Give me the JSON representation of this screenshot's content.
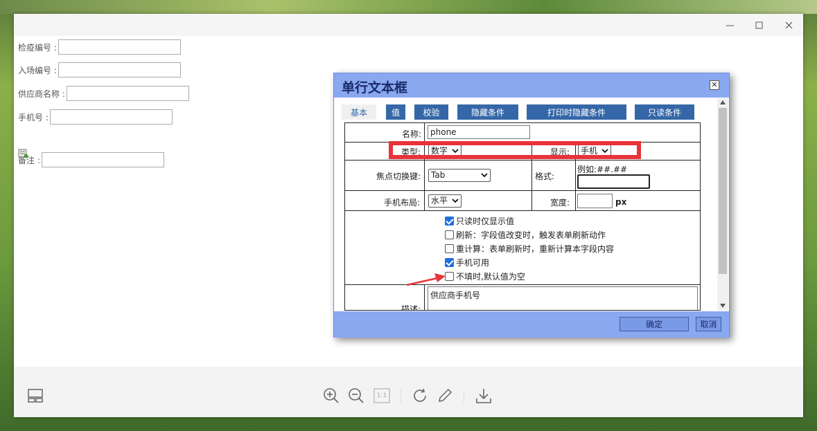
{
  "form": {
    "field_1_label": "检疫编号 :",
    "field_2_label": "入场编号 :",
    "field_3_label": "供应商名称 :",
    "field_4_label": "手机号 :",
    "field_5_label": "备注 :"
  },
  "dialog": {
    "title": "单行文本框",
    "tabs": [
      "基本",
      "值",
      "校验",
      "隐藏条件",
      "打印时隐藏条件",
      "只读条件"
    ],
    "name_label": "名称:",
    "name_value": "phone",
    "type_label": "类型:",
    "type_value": "数字",
    "display_label": "显示:",
    "display_value": "手机",
    "focus_label": "焦点切换键:",
    "focus_value": "Tab",
    "format_label": "格式:",
    "format_hint": "例如:##.##",
    "mobile_layout_label": "手机布局:",
    "mobile_layout_value": "水平",
    "width_label": "宽度:",
    "width_unit": "px",
    "checkboxes": [
      {
        "label": "只读时仅显示值",
        "checked": true
      },
      {
        "label": "刷新：字段值改变时，触发表单刷新动作",
        "checked": false
      },
      {
        "label": "重计算：表单刷新时，重新计算本字段内容",
        "checked": false
      },
      {
        "label": "手机可用",
        "checked": true
      },
      {
        "label": "不填时,默认值为空",
        "checked": false
      }
    ],
    "desc_label": "描述:",
    "desc_value": "供应商手机号",
    "ok_label": "确定",
    "cancel_label": "取消"
  },
  "colors": {
    "dialog_header": "#8aa8f0",
    "tab_bg": "#3567a8",
    "highlight": "#e8333a",
    "checkbox_on": "#1f6fe0"
  },
  "toolbar_icons": [
    "layout-icon",
    "zoom-in-icon",
    "zoom-out-icon",
    "actual-size-icon",
    "rotate-icon",
    "pen-icon",
    "download-icon"
  ],
  "toolbar": {
    "actual_size_label": "1:1"
  }
}
